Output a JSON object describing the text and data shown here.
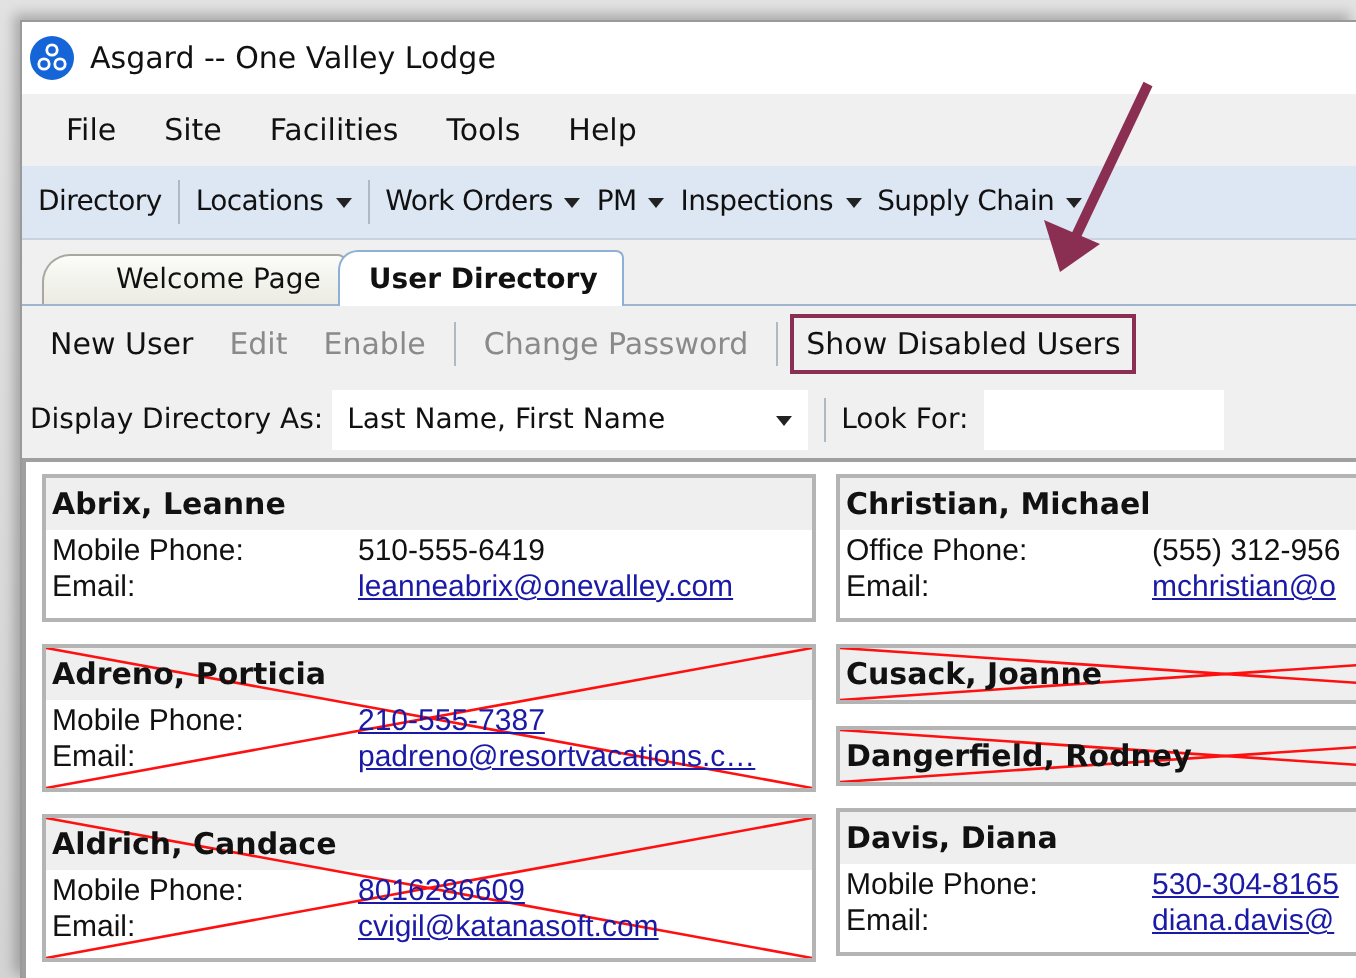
{
  "window": {
    "title": "Asgard -- One Valley Lodge"
  },
  "menu": [
    "File",
    "Site",
    "Facilities",
    "Tools",
    "Help"
  ],
  "toolbar": [
    {
      "label": "Directory",
      "dropdown": false,
      "separator_after": true
    },
    {
      "label": "Locations",
      "dropdown": true,
      "separator_after": true
    },
    {
      "label": "Work Orders",
      "dropdown": true,
      "separator_after": false
    },
    {
      "label": "PM",
      "dropdown": true,
      "separator_after": false
    },
    {
      "label": "Inspections",
      "dropdown": true,
      "separator_after": false
    },
    {
      "label": "Supply Chain",
      "dropdown": true,
      "separator_after": false
    }
  ],
  "tabs": [
    {
      "label": "Welcome Page",
      "selected": false
    },
    {
      "label": "User Directory",
      "selected": true
    }
  ],
  "commands": [
    {
      "label": "New User",
      "disabled": false,
      "highlighted": false,
      "separator_after": false
    },
    {
      "label": "Edit",
      "disabled": true,
      "highlighted": false,
      "separator_after": false
    },
    {
      "label": "Enable",
      "disabled": true,
      "highlighted": false,
      "separator_after": true
    },
    {
      "label": "Change Password",
      "disabled": true,
      "highlighted": false,
      "separator_after": true
    },
    {
      "label": "Show Disabled Users",
      "disabled": false,
      "highlighted": true,
      "separator_after": false
    }
  ],
  "display": {
    "label": "Display Directory As:",
    "value": "Last Name, First Name",
    "look_for_label": "Look For:"
  },
  "columns": [
    {
      "cards": [
        {
          "name": "Abrix, Leanne",
          "disabled": false,
          "fields": [
            {
              "label": "Mobile Phone:",
              "value": "510-555-6419",
              "link": false
            },
            {
              "label": "Email:",
              "value": "leanneabrix@onevalley.com",
              "link": true
            }
          ]
        },
        {
          "name": "Adreno, Porticia",
          "disabled": true,
          "fields": [
            {
              "label": "Mobile Phone:",
              "value": "210-555-7387",
              "link": true
            },
            {
              "label": "Email:",
              "value": "padreno@resortvacations.c…",
              "link": true
            }
          ]
        },
        {
          "name": "Aldrich, Candace",
          "disabled": true,
          "fields": [
            {
              "label": "Mobile Phone:",
              "value": "8016286609",
              "link": true
            },
            {
              "label": "Email:",
              "value": "cvigil@katanasoft.com",
              "link": true
            }
          ]
        }
      ]
    },
    {
      "cards": [
        {
          "name": "Christian, Michael",
          "disabled": false,
          "fields": [
            {
              "label": "Office Phone:",
              "value": "(555) 312-956",
              "link": false
            },
            {
              "label": "Email:",
              "value": "mchristian@o",
              "link": true
            }
          ]
        },
        {
          "name": "Cusack, Joanne",
          "disabled": true
        },
        {
          "name": "Dangerfield, Rodney",
          "disabled": true
        },
        {
          "name": "Davis, Diana",
          "disabled": false,
          "fields": [
            {
              "label": "Mobile Phone:",
              "value": "530-304-8165",
              "link": true
            },
            {
              "label": "Email:",
              "value": "diana.davis@",
              "link": true
            }
          ]
        }
      ]
    }
  ]
}
